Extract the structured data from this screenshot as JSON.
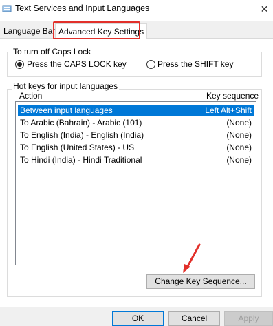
{
  "window": {
    "title": "Text Services and Input Languages",
    "close_glyph": "✕"
  },
  "tabs": [
    {
      "label": "Language Bar",
      "selected": false
    },
    {
      "label": "Advanced Key Settings",
      "selected": true
    }
  ],
  "caps_lock": {
    "group_title": "To turn off Caps Lock",
    "options": [
      {
        "label": "Press the CAPS LOCK key",
        "checked": true
      },
      {
        "label": "Press the SHIFT key",
        "checked": false
      }
    ]
  },
  "hotkeys": {
    "group_title": "Hot keys for input languages",
    "columns": {
      "action": "Action",
      "key_sequence": "Key sequence"
    },
    "rows": [
      {
        "action": "Between input languages",
        "key": "Left Alt+Shift",
        "selected": true
      },
      {
        "action": "To Arabic (Bahrain) - Arabic (101)",
        "key": "(None)",
        "selected": false
      },
      {
        "action": "To English (India) - English (India)",
        "key": "(None)",
        "selected": false
      },
      {
        "action": "To English (United States) - US",
        "key": "(None)",
        "selected": false
      },
      {
        "action": "To Hindi (India) - Hindi Traditional",
        "key": "(None)",
        "selected": false
      }
    ],
    "change_button": "Change Key Sequence..."
  },
  "footer": {
    "ok": "OK",
    "cancel": "Cancel",
    "apply": "Apply"
  },
  "colors": {
    "selection": "#0078d7",
    "highlight_box": "#e2302a",
    "arrow": "#e2302a"
  },
  "icons": {
    "app": "keyboard-settings-icon",
    "close": "close-icon",
    "annotation": "red-arrow-icon"
  }
}
